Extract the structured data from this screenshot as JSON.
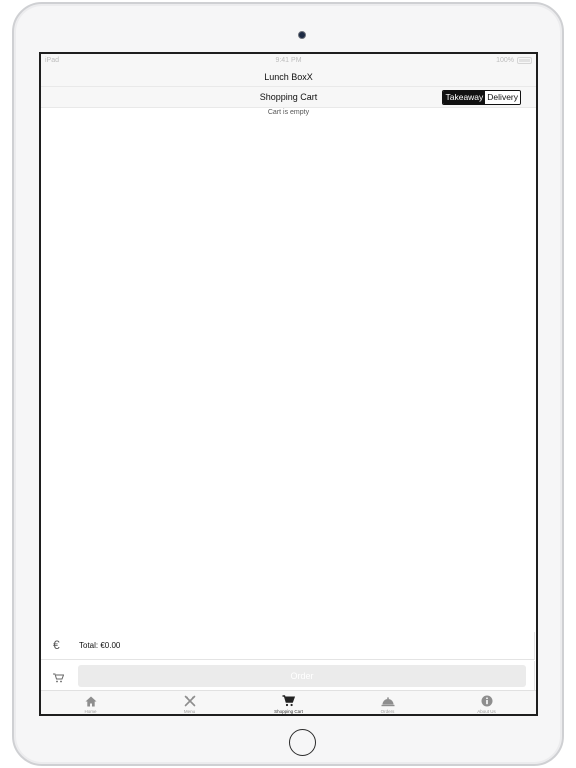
{
  "status_bar": {
    "carrier": "iPad",
    "time": "9:41 PM",
    "battery": "100%"
  },
  "nav": {
    "title": "Lunch BoxX"
  },
  "cart": {
    "title": "Shopping Cart",
    "segments": [
      "Takeaway",
      "Delivery"
    ],
    "selected_segment": "Takeaway",
    "empty_message": "Cart is empty",
    "currency_icon": "euro-icon",
    "total_text": "Total: €0.00",
    "order_label": "Order"
  },
  "tabs": [
    {
      "label": "Home",
      "icon": "home-icon"
    },
    {
      "label": "Menu",
      "icon": "utensils-icon"
    },
    {
      "label": "Shopping Cart",
      "icon": "cart-icon",
      "selected": true
    },
    {
      "label": "Orders",
      "icon": "cloche-icon"
    },
    {
      "label": "About Us",
      "icon": "info-icon"
    }
  ],
  "colors": {
    "active_segment": "#111111",
    "order_button": "#ebebeb",
    "tab_inactive": "#9a9a9a"
  }
}
